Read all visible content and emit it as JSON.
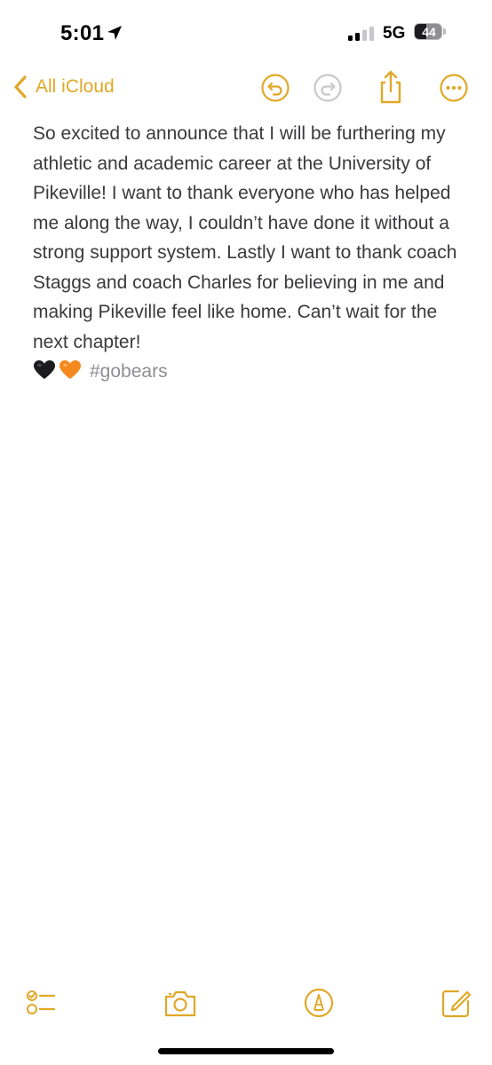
{
  "status_bar": {
    "time": "5:01",
    "network": "5G",
    "battery_level": "44",
    "battery_fraction": 0.44,
    "icons": [
      "location-arrow-icon",
      "cellular-signal-icon",
      "battery-icon"
    ]
  },
  "nav": {
    "back_label": "All iCloud",
    "icons": [
      "undo-icon",
      "redo-icon",
      "share-icon",
      "more-icon"
    ]
  },
  "note": {
    "text": "So excited to announce that I will be furthering my athletic and academic career at the University of Pikeville! I want to thank everyone who has helped me along the way, I couldn’t have done it without a strong support system. Lastly I want to thank coach Staggs and coach Charles for believing in me and making Pikeville feel like home. Can’t wait for the next chapter!",
    "emojis": [
      "black-heart-icon",
      "orange-heart-icon"
    ],
    "hashtag": "#gobears"
  },
  "toolbar": {
    "icons": [
      "checklist-icon",
      "camera-icon",
      "markup-icon",
      "compose-icon"
    ]
  },
  "colors": {
    "accent": "#e0a826",
    "text": "#3a3a3c",
    "hashtag": "#8e8e93",
    "background": "#ffffff"
  }
}
